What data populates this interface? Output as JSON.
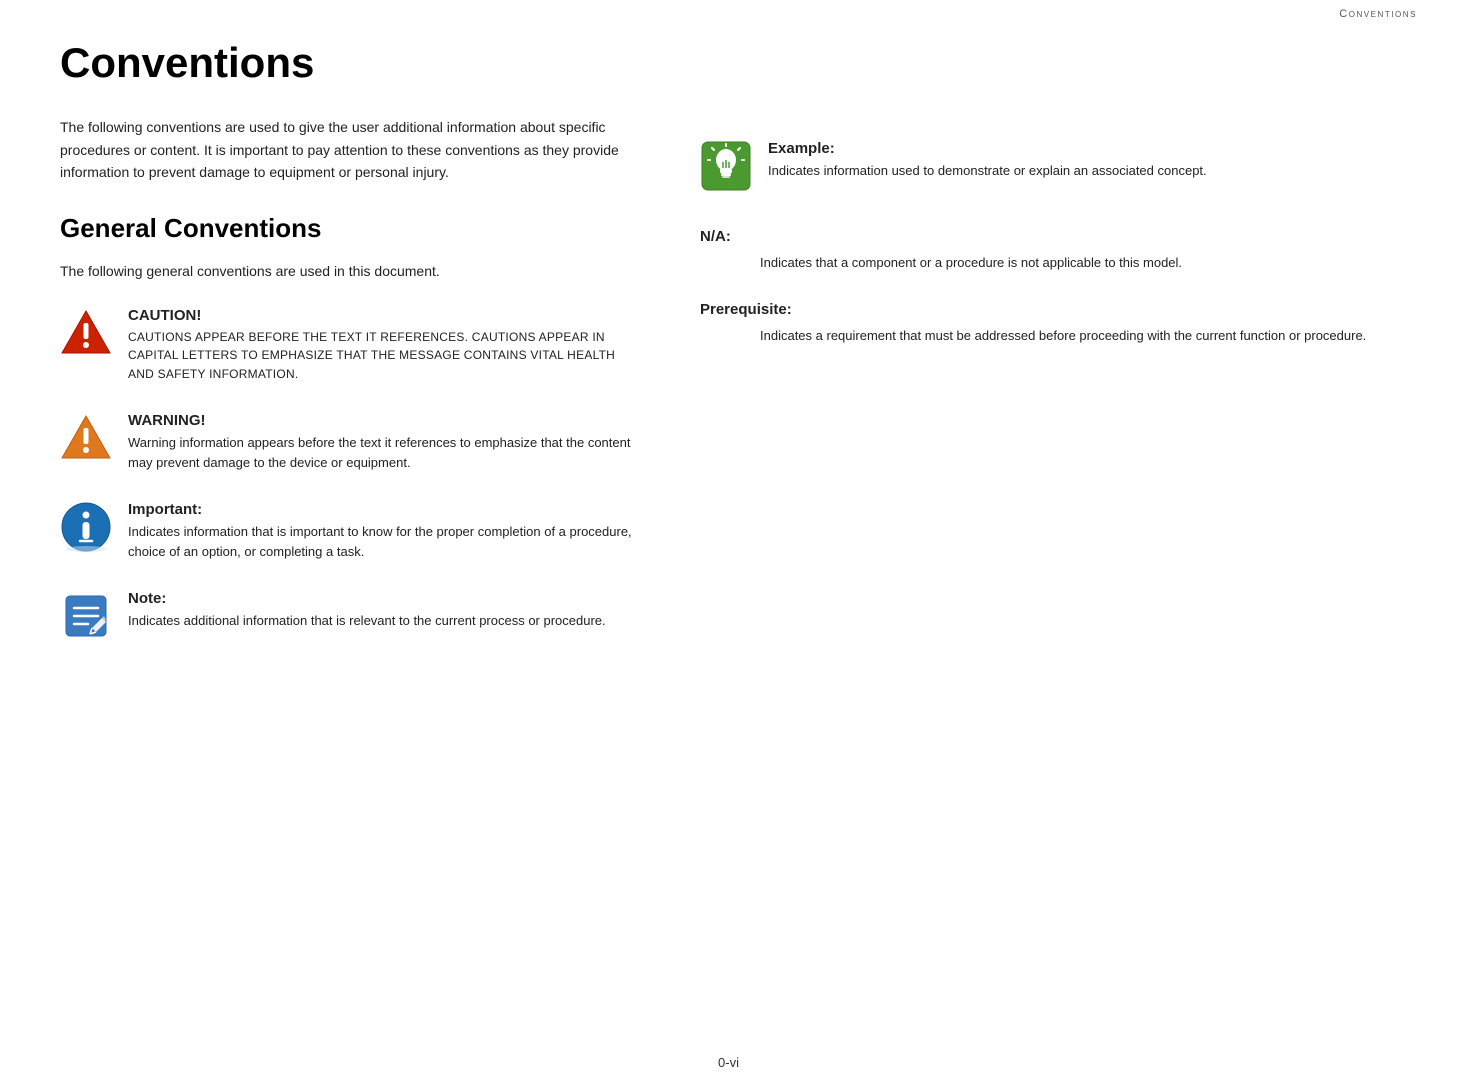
{
  "header": {
    "title": "Conventions"
  },
  "page_title": "Conventions",
  "intro_text": "The following conventions are used to give the user additional information about specific procedures or content. It is important to pay attention to these conventions as they provide information to prevent damage to equipment or personal injury.",
  "general_section": {
    "title": "General Conventions",
    "intro": "The following general conventions are used in this document."
  },
  "conventions": [
    {
      "id": "caution",
      "label": "CAUTION!",
      "description": "CAUTIONS APPEAR BEFORE THE TEXT IT REFERENCES. CAUTIONS APPEAR IN CAPITAL LETTERS TO EMPHASIZE THAT THE MESSAGE CONTAINS VITAL HEALTH AND SAFETY INFORMATION.",
      "uppercase": true
    },
    {
      "id": "warning",
      "label": "WARNING!",
      "description": "Warning information appears before the text it references to emphasize that the content may prevent damage to the device or equipment.",
      "uppercase": false
    },
    {
      "id": "important",
      "label": "Important:",
      "description": "Indicates information that is important to know for the proper completion of a procedure, choice of an option, or completing a task.",
      "uppercase": false
    },
    {
      "id": "note",
      "label": "Note:",
      "description": "Indicates additional information that is relevant to the current process or procedure.",
      "uppercase": false
    }
  ],
  "right_conventions": [
    {
      "id": "example",
      "label": "Example:",
      "description": "Indicates information used to demonstrate or explain an associated concept."
    }
  ],
  "na": {
    "label": "N/A:",
    "description": "Indicates that a component or a procedure is not applicable to this model."
  },
  "prerequisite": {
    "label": "Prerequisite:",
    "description": "Indicates a requirement that must be addressed before proceeding with the current function or procedure."
  },
  "footer": {
    "page_number": "0-vi"
  },
  "colors": {
    "caution_red": "#cc0000",
    "warning_orange": "#e07000",
    "important_blue": "#1a6fb5",
    "note_blue": "#3a7abf",
    "example_green": "#4a9a30",
    "accent": "#000"
  }
}
